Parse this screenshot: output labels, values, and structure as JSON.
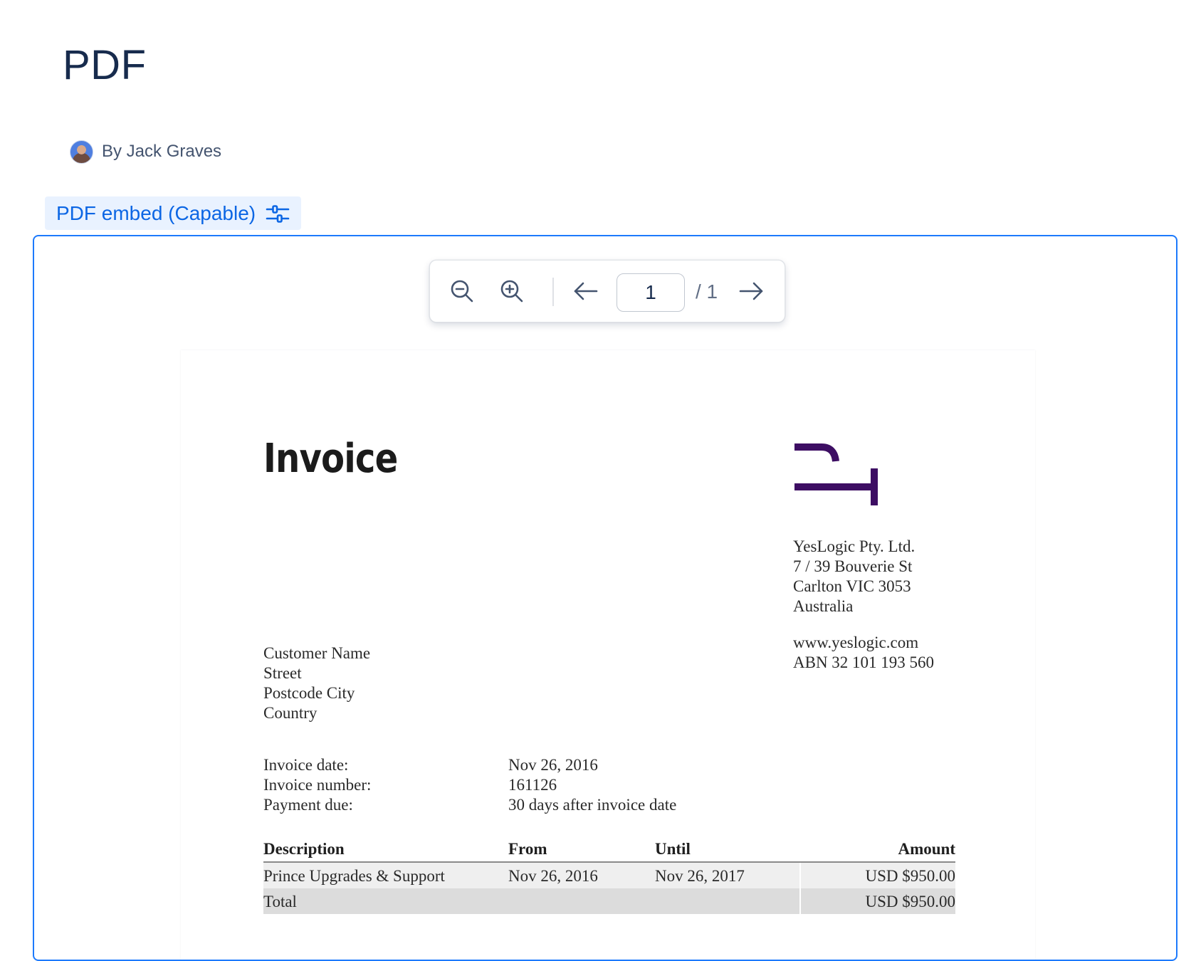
{
  "page": {
    "title": "PDF",
    "byline": "By Jack Graves",
    "macro_label": "PDF embed (Capable)"
  },
  "viewer": {
    "current_page": "1",
    "page_total": "/ 1",
    "icons": [
      "zoom-out-icon",
      "zoom-in-icon",
      "arrow-left-icon",
      "arrow-right-icon",
      "settings-sliders-icon"
    ]
  },
  "invoice": {
    "title": "Invoice",
    "company": [
      "YesLogic Pty. Ltd.",
      "7 / 39 Bouverie St",
      "Carlton VIC 3053",
      "Australia"
    ],
    "web": [
      "www.yeslogic.com",
      "ABN 32 101 193 560"
    ],
    "customer": [
      "Customer Name",
      "Street",
      "Postcode City",
      "Country"
    ],
    "meta": [
      {
        "label": "Invoice date:",
        "value": "Nov 26, 2016"
      },
      {
        "label": "Invoice number:",
        "value": "161126"
      },
      {
        "label": "Payment due:",
        "value": "30 days after invoice date"
      }
    ],
    "table": {
      "headers": [
        "Description",
        "From",
        "Until",
        "Amount"
      ],
      "rows": [
        [
          "Prince Upgrades & Support",
          "Nov 26, 2016",
          "Nov 26, 2017",
          "USD $950.00"
        ]
      ],
      "total": {
        "label": "Total",
        "amount": "USD $950.00"
      }
    },
    "logo_color": "#3d0e63"
  },
  "colors": {
    "frame_border": "#1d7afc",
    "macro_bg": "#e9f2ff",
    "macro_text": "#0c66e4"
  }
}
